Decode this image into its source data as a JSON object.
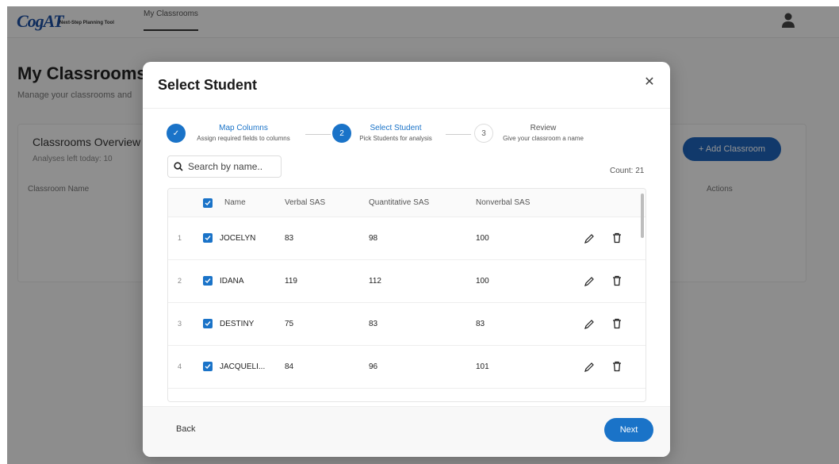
{
  "app": {
    "logo_text": "CogAT",
    "logo_subtitle": "Next-Step Planning Tool",
    "nav_tab": "My Classrooms"
  },
  "background": {
    "page_title": "My Classrooms",
    "page_subtitle": "Manage your classrooms and",
    "card_title": "Classrooms Overview",
    "card_subtitle": "Analyses left today: 10",
    "col_classroom_name": "Classroom Name",
    "col_actions": "Actions",
    "add_button": "+ Add Classroom"
  },
  "modal": {
    "title": "Select Student",
    "close_icon": "close-icon",
    "steps": [
      {
        "number": "✓",
        "title": "Map Columns",
        "desc": "Assign required fields to columns",
        "state": "complete"
      },
      {
        "number": "2",
        "title": "Select Student",
        "desc": "Pick Students for analysis",
        "state": "active"
      },
      {
        "number": "3",
        "title": "Review",
        "desc": "Give your classroom a name",
        "state": "pending"
      }
    ],
    "search_placeholder": "Search by name..",
    "count_label": "Count: 21",
    "table": {
      "headers": {
        "name": "Name",
        "verbal": "Verbal SAS",
        "quant": "Quantitative SAS",
        "nonverbal": "Nonverbal SAS"
      },
      "rows": [
        {
          "index": "1",
          "name": "JOCELYN",
          "verbal": "83",
          "quant": "98",
          "nonverbal": "100",
          "checked": true
        },
        {
          "index": "2",
          "name": "IDANA",
          "verbal": "119",
          "quant": "112",
          "nonverbal": "100",
          "checked": true
        },
        {
          "index": "3",
          "name": "DESTINY",
          "verbal": "75",
          "quant": "83",
          "nonverbal": "83",
          "checked": true
        },
        {
          "index": "4",
          "name": "JACQUELI...",
          "verbal": "84",
          "quant": "96",
          "nonverbal": "101",
          "checked": true
        }
      ]
    },
    "back_label": "Back",
    "next_label": "Next"
  },
  "colors": {
    "accent": "#1a73c8",
    "overlay": "rgba(0,0,0,0.42)"
  }
}
